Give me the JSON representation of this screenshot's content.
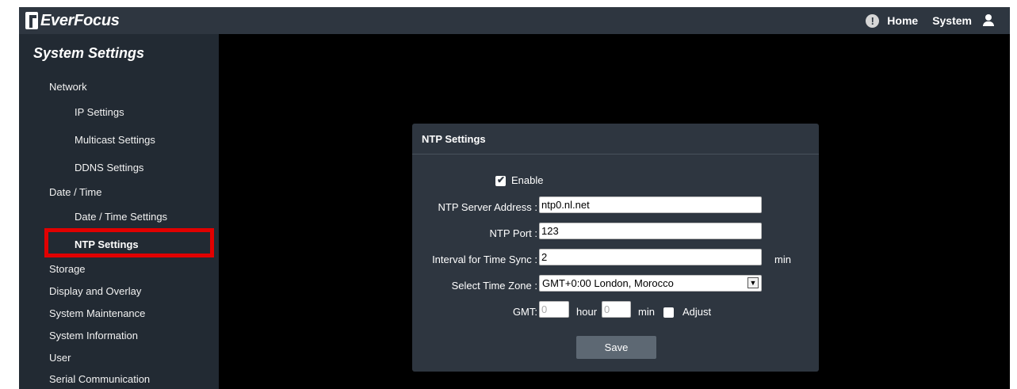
{
  "header": {
    "logo_text": "EverFocus",
    "nav": [
      "Home",
      "System"
    ]
  },
  "sidebar": {
    "title": "System Settings",
    "items": [
      {
        "label": "Network"
      },
      {
        "label": "IP Settings"
      },
      {
        "label": "Multicast Settings"
      },
      {
        "label": "DDNS Settings"
      },
      {
        "label": "Date / Time"
      },
      {
        "label": "Date / Time Settings"
      },
      {
        "label": "NTP Settings",
        "active": true
      },
      {
        "label": "Storage"
      },
      {
        "label": "Display and Overlay"
      },
      {
        "label": "System Maintenance"
      },
      {
        "label": "System Information"
      },
      {
        "label": "User"
      },
      {
        "label": "Serial Communication"
      }
    ]
  },
  "panel": {
    "title": "NTP Settings",
    "enable_label": "Enable",
    "enable_checked": true,
    "server_label": "NTP Server Address :",
    "server_value": "ntp0.nl.net",
    "port_label": "NTP Port :",
    "port_value": "123",
    "interval_label": "Interval for Time Sync :",
    "interval_value": "2",
    "interval_unit": "min",
    "timezone_label": "Select Time Zone :",
    "timezone_value": "GMT+0:00 London, Morocco",
    "gmt_label": "GMT:",
    "gmt_hour_value": "0",
    "hour_label": "hour",
    "gmt_min_value": "0",
    "min_label": "min",
    "adjust_label": "Adjust",
    "adjust_checked": false,
    "save_label": "Save"
  },
  "colors": {
    "topbar": "#2e3640",
    "sidebar": "#222a33",
    "highlight": "#e10000",
    "save_button": "#5d6873"
  }
}
